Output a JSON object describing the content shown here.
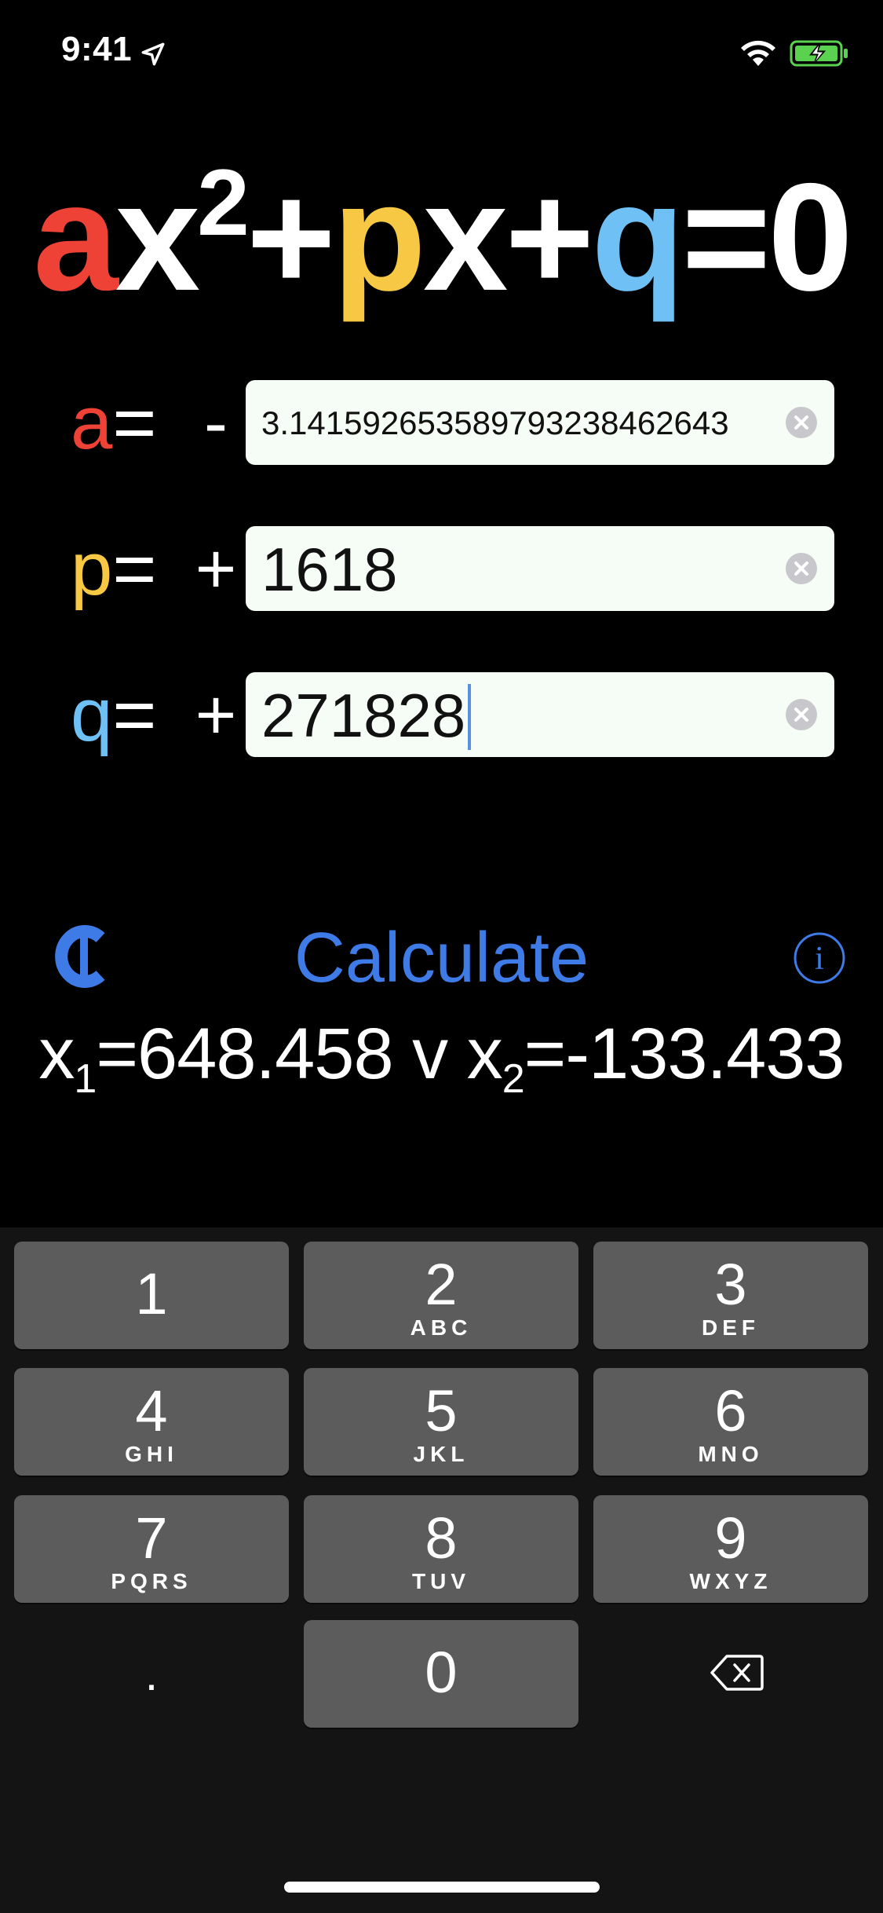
{
  "status_bar": {
    "time": "9:41",
    "icons": [
      "location-arrow-icon",
      "wifi-icon",
      "battery-charging-icon"
    ],
    "battery_color": "#5bd24f"
  },
  "equation": {
    "parts": [
      "a",
      "x",
      "2",
      "+",
      "p",
      "x",
      "+",
      "q",
      "=0"
    ],
    "colors": {
      "a": "#ee4236",
      "p": "#f7c844",
      "q": "#6ec0f5"
    }
  },
  "coefficients": [
    {
      "name": "a",
      "label": "a=",
      "sign": "-",
      "value": "3.14159265358979323846264 3"
    },
    {
      "name": "p",
      "label": "p=",
      "sign": "+",
      "value": "1618"
    },
    {
      "name": "q",
      "label": "q=",
      "sign": "+",
      "value": "271828"
    }
  ],
  "actions": {
    "calculate_label": "Calculate",
    "info_label": "i",
    "accent_color": "#3e7be6"
  },
  "result": {
    "x1_name": "x",
    "x1_sub": "1",
    "x1_value": "=648.458",
    "separator": " v ",
    "x2_name": "x",
    "x2_sub": "2",
    "x2_value": "=-133.433"
  },
  "keyboard": {
    "keys": [
      {
        "digit": "1",
        "letters": ""
      },
      {
        "digit": "2",
        "letters": "ABC"
      },
      {
        "digit": "3",
        "letters": "DEF"
      },
      {
        "digit": "4",
        "letters": "GHI"
      },
      {
        "digit": "5",
        "letters": "JKL"
      },
      {
        "digit": "6",
        "letters": "MNO"
      },
      {
        "digit": "7",
        "letters": "PQRS"
      },
      {
        "digit": "8",
        "letters": "TUV"
      },
      {
        "digit": "9",
        "letters": "WXYZ"
      },
      {
        "digit": "0",
        "letters": ""
      }
    ],
    "dot_label": ".",
    "delete_icon": "backspace-icon"
  }
}
